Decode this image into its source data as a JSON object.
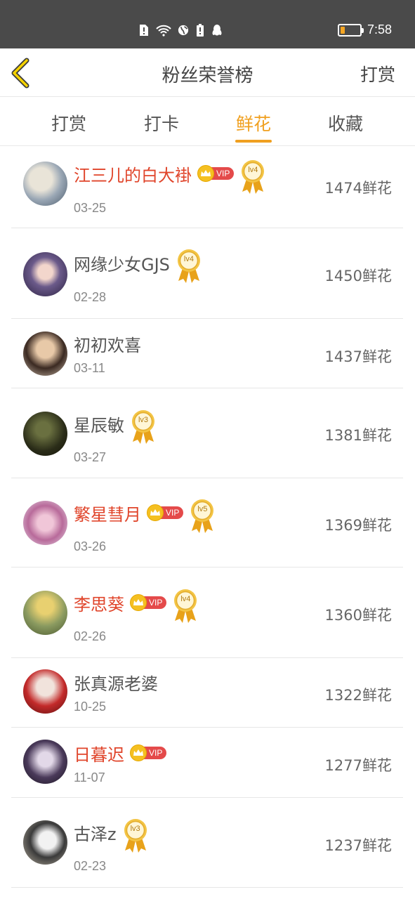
{
  "status_bar": {
    "time": "7:58"
  },
  "header": {
    "title": "粉丝荣誉榜",
    "right_action": "打赏"
  },
  "tabs": [
    {
      "label": "打赏",
      "active": false
    },
    {
      "label": "打卡",
      "active": false
    },
    {
      "label": "鲜花",
      "active": true
    },
    {
      "label": "收藏",
      "active": false
    }
  ],
  "colors": {
    "accent": "#f0a020",
    "vip_name": "#e0452b",
    "vip_badge": "#e44a4a"
  },
  "fans": [
    {
      "name": "江三儿的白大褂",
      "vip": true,
      "vip_label": "VIP",
      "level": "lv4",
      "date": "03-25",
      "count": "1474鲜花"
    },
    {
      "name": "网缘少女GJS",
      "vip": false,
      "vip_label": "",
      "level": "lv4",
      "date": "02-28",
      "count": "1450鲜花"
    },
    {
      "name": "初初欢喜",
      "vip": false,
      "vip_label": "",
      "level": "",
      "date": "03-11",
      "count": "1437鲜花"
    },
    {
      "name": "星辰敏",
      "vip": false,
      "vip_label": "",
      "level": "lv3",
      "date": "03-27",
      "count": "1381鲜花"
    },
    {
      "name": "繁星彗月",
      "vip": true,
      "vip_label": "VIP",
      "level": "lv5",
      "date": "03-26",
      "count": "1369鲜花"
    },
    {
      "name": "李思葵",
      "vip": true,
      "vip_label": "VIP",
      "level": "lv4",
      "date": "02-26",
      "count": "1360鲜花"
    },
    {
      "name": "张真源老婆",
      "vip": false,
      "vip_label": "",
      "level": "",
      "date": "10-25",
      "count": "1322鲜花"
    },
    {
      "name": "日暮迟",
      "vip": true,
      "vip_label": "VIP",
      "level": "",
      "date": "11-07",
      "count": "1277鲜花"
    },
    {
      "name": "古泽z",
      "vip": false,
      "vip_label": "",
      "level": "lv3",
      "date": "02-23",
      "count": "1237鲜花"
    }
  ]
}
